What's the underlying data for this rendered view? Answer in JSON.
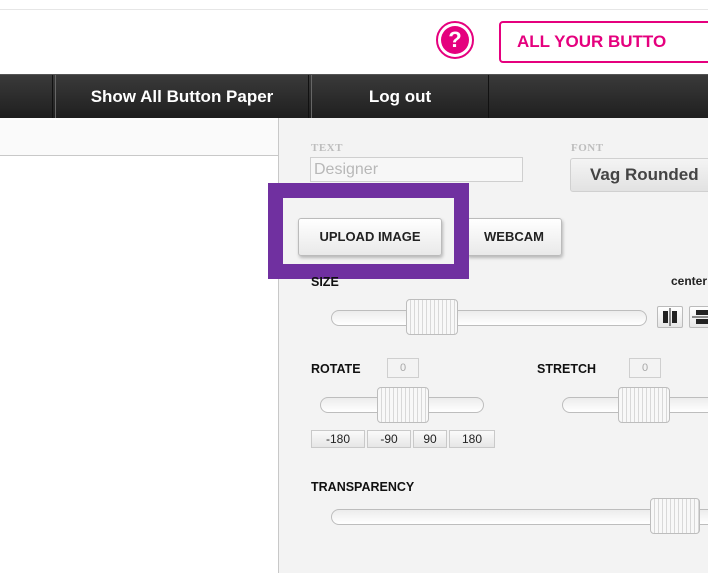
{
  "header": {
    "help_symbol": "?",
    "all_buttons_label": "ALL YOUR BUTTO",
    "accent_color": "#e5007e"
  },
  "nav": {
    "items": [
      {
        "label": ""
      },
      {
        "label": "Show All Button Paper"
      },
      {
        "label": "Log out"
      }
    ]
  },
  "panel": {
    "text_label": "TEXT",
    "text_placeholder": "Designer",
    "font_label": "FONT",
    "font_value": "Vag Rounded",
    "upload_label": "UPLOAD IMAGE",
    "webcam_label": "WEBCAM",
    "highlight_color": "#7030a0",
    "size": {
      "label": "SIZE",
      "center_label": "center"
    },
    "rotate": {
      "label": "ROTATE",
      "value": "0",
      "presets": [
        "-180",
        "-90",
        "90",
        "180"
      ]
    },
    "stretch": {
      "label": "STRETCH",
      "value": "0"
    },
    "transparency": {
      "label": "TRANSPARENCY"
    }
  }
}
